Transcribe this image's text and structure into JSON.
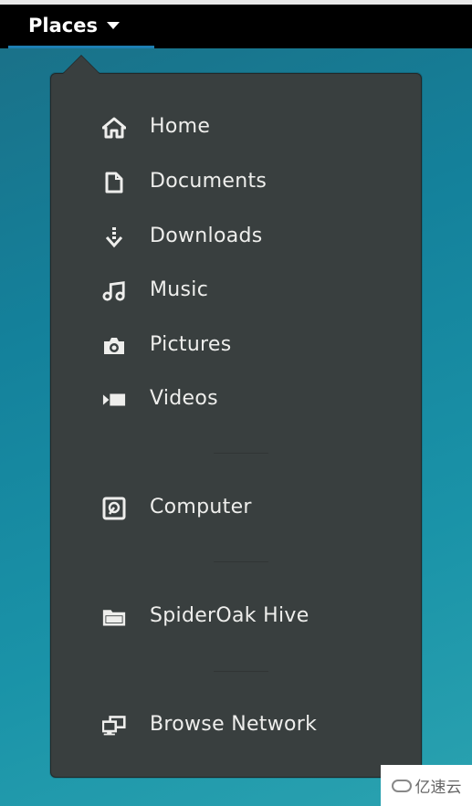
{
  "topbar": {
    "places_label": "Places"
  },
  "menu": {
    "items": [
      {
        "label": "Home",
        "icon": "home-icon"
      },
      {
        "label": "Documents",
        "icon": "document-icon"
      },
      {
        "label": "Downloads",
        "icon": "download-icon"
      },
      {
        "label": "Music",
        "icon": "music-icon"
      },
      {
        "label": "Pictures",
        "icon": "camera-icon"
      },
      {
        "label": "Videos",
        "icon": "video-icon"
      },
      {
        "label": "Computer",
        "icon": "computer-icon"
      },
      {
        "label": "SpiderOak Hive",
        "icon": "folder-icon"
      },
      {
        "label": "Browse Network",
        "icon": "network-icon"
      }
    ]
  },
  "watermark": {
    "text": "亿速云"
  }
}
